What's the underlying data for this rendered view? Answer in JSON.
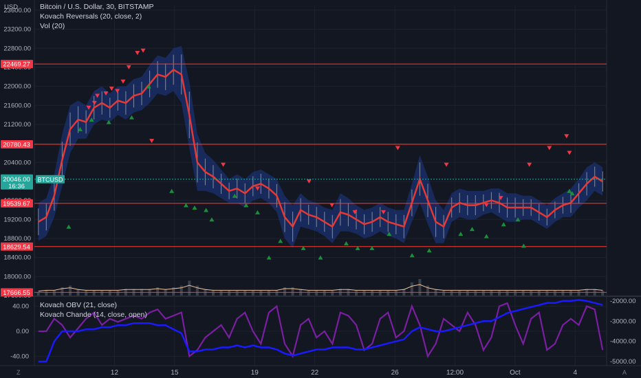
{
  "chart_data": {
    "type": "line",
    "instrument": "Bitcoin / U.S. Dollar, 30, BITSTAMP",
    "currency_label": "USD",
    "indicators_top": [
      "Kovach Reversals (20, close, 2)",
      "Vol (20)"
    ],
    "indicators_bottom": [
      "Kovach OBV (21, close)",
      "Kovach Chande (14, close, open)"
    ],
    "price_axis": {
      "ylim": [
        17600,
        23700
      ],
      "ticks": [
        23600,
        23200,
        22800,
        22400,
        22000,
        21600,
        21200,
        20800,
        20400,
        20000,
        19600,
        19200,
        18800,
        18400,
        18000,
        17600
      ],
      "tick_labels": [
        "23600.00",
        "23200.00",
        "22800.00",
        "22400.00",
        "22000.00",
        "21600.00",
        "21200.00",
        "20800.00",
        "20400.00",
        "20000.00",
        "19600.00",
        "19200.00",
        "18800.00",
        "18400.00",
        "18000.00",
        "17600.00"
      ]
    },
    "levels": [
      {
        "value": 22469.27,
        "label": "22469.27"
      },
      {
        "value": 20780.43,
        "label": "20780.43"
      },
      {
        "value": 19539.67,
        "label": "19539.67"
      },
      {
        "value": 18629.54,
        "label": "18629.54"
      },
      {
        "value": 17666.55,
        "label": "17666.55"
      }
    ],
    "current_price": {
      "value": 20046.0,
      "label": "20046.00",
      "countdown": "16:36",
      "symbol": "BTCUSD"
    },
    "x_ticks": [
      {
        "label": "12",
        "t": 0.14
      },
      {
        "label": "15",
        "t": 0.245
      },
      {
        "label": "19",
        "t": 0.385
      },
      {
        "label": "22",
        "t": 0.49
      },
      {
        "label": "26",
        "t": 0.63
      },
      {
        "label": "12:00",
        "t": 0.735
      },
      {
        "label": "Oct",
        "t": 0.84
      },
      {
        "label": "4",
        "t": 0.945
      }
    ],
    "price_series": [
      19150,
      19250,
      19700,
      20450,
      21100,
      21300,
      21250,
      21550,
      21650,
      21550,
      21700,
      21650,
      21800,
      21850,
      22050,
      22250,
      22200,
      22350,
      22250,
      21400,
      20400,
      20200,
      20100,
      19950,
      19800,
      19850,
      19750,
      19900,
      19950,
      19850,
      19700,
      19250,
      19050,
      19400,
      19300,
      19250,
      19150,
      19050,
      19350,
      19300,
      19200,
      19100,
      19150,
      19250,
      19150,
      19100,
      19050,
      19550,
      20050,
      19600,
      19150,
      19050,
      19450,
      19550,
      19500,
      19500,
      19550,
      19600,
      19550,
      19450,
      19450,
      19450,
      19450,
      19350,
      19250,
      19400,
      19500,
      19550,
      19750,
      19950,
      20100,
      20000
    ],
    "band_series": [
      400,
      400,
      450,
      550,
      500,
      400,
      350,
      350,
      350,
      300,
      300,
      350,
      350,
      350,
      400,
      400,
      400,
      450,
      600,
      700,
      600,
      400,
      350,
      300,
      250,
      300,
      300,
      300,
      300,
      300,
      350,
      450,
      450,
      350,
      300,
      300,
      300,
      350,
      400,
      350,
      300,
      300,
      300,
      300,
      300,
      300,
      350,
      400,
      500,
      500,
      450,
      350,
      300,
      300,
      300,
      300,
      250,
      250,
      300,
      300,
      300,
      250,
      250,
      250,
      250,
      250,
      250,
      300,
      300,
      350,
      300,
      300
    ],
    "reversal_down": [
      [
        0.095,
        21550
      ],
      [
        0.105,
        21650
      ],
      [
        0.11,
        21800
      ],
      [
        0.125,
        21850
      ],
      [
        0.135,
        21950
      ],
      [
        0.145,
        21900
      ],
      [
        0.155,
        22100
      ],
      [
        0.165,
        22400
      ],
      [
        0.18,
        22700
      ],
      [
        0.19,
        22750
      ],
      [
        0.205,
        20850
      ],
      [
        0.33,
        20350
      ],
      [
        0.39,
        19850
      ],
      [
        0.48,
        20000
      ],
      [
        0.52,
        19500
      ],
      [
        0.56,
        19350
      ],
      [
        0.61,
        19350
      ],
      [
        0.635,
        20700
      ],
      [
        0.72,
        20350
      ],
      [
        0.79,
        19500
      ],
      [
        0.815,
        19650
      ],
      [
        0.865,
        20350
      ],
      [
        0.9,
        20700
      ],
      [
        0.93,
        20950
      ],
      [
        0.935,
        20600
      ]
    ],
    "reversal_up": [
      [
        0.06,
        19050
      ],
      [
        0.08,
        21100
      ],
      [
        0.1,
        21300
      ],
      [
        0.13,
        21250
      ],
      [
        0.17,
        21350
      ],
      [
        0.2,
        22000
      ],
      [
        0.24,
        19800
      ],
      [
        0.265,
        19500
      ],
      [
        0.28,
        19450
      ],
      [
        0.3,
        19400
      ],
      [
        0.31,
        19200
      ],
      [
        0.35,
        19700
      ],
      [
        0.37,
        19500
      ],
      [
        0.39,
        19350
      ],
      [
        0.41,
        18400
      ],
      [
        0.43,
        18750
      ],
      [
        0.47,
        18600
      ],
      [
        0.5,
        18400
      ],
      [
        0.545,
        18700
      ],
      [
        0.565,
        18600
      ],
      [
        0.59,
        18600
      ],
      [
        0.62,
        18900
      ],
      [
        0.66,
        18450
      ],
      [
        0.69,
        18550
      ],
      [
        0.745,
        18900
      ],
      [
        0.765,
        19000
      ],
      [
        0.79,
        18850
      ],
      [
        0.82,
        19100
      ],
      [
        0.845,
        19200
      ],
      [
        0.855,
        18650
      ],
      [
        0.935,
        19800
      ],
      [
        0.94,
        19750
      ]
    ],
    "volume_series": [
      0.2,
      0.3,
      0.3,
      0.5,
      0.6,
      0.4,
      0.3,
      0.3,
      0.3,
      0.3,
      0.3,
      0.4,
      0.4,
      0.4,
      0.4,
      0.5,
      0.4,
      0.5,
      0.6,
      0.9,
      0.6,
      0.4,
      0.3,
      0.3,
      0.3,
      0.3,
      0.3,
      0.3,
      0.3,
      0.3,
      0.3,
      0.5,
      0.5,
      0.4,
      0.3,
      0.3,
      0.3,
      0.3,
      0.4,
      0.4,
      0.3,
      0.3,
      0.3,
      0.3,
      0.3,
      0.3,
      0.4,
      0.8,
      1.0,
      0.6,
      0.4,
      0.3,
      0.3,
      0.3,
      0.3,
      0.3,
      0.3,
      0.3,
      0.3,
      0.3,
      0.3,
      0.3,
      0.3,
      0.3,
      0.3,
      0.3,
      0.3,
      0.3,
      0.3,
      0.4,
      0.4,
      0.3
    ],
    "oscillator_axis": {
      "left_ylim": [
        -55,
        55
      ],
      "left_ticks": [
        40,
        0,
        -40
      ],
      "left_tick_labels": [
        "40.00",
        "0.00",
        "-40.00"
      ],
      "right_ylim": [
        -5200,
        -1800
      ],
      "right_ticks": [
        -2000,
        -3000,
        -4000,
        -5000
      ],
      "right_tick_labels": [
        "-2000.00",
        "-3000.00",
        "-4000.00",
        "-5000.00"
      ]
    },
    "obv_series": [
      -5000,
      -5000,
      -4000,
      -3500,
      -3500,
      -3500,
      -3400,
      -3400,
      -3300,
      -3300,
      -3200,
      -3200,
      -3100,
      -3100,
      -3100,
      -3200,
      -3200,
      -3400,
      -3600,
      -4500,
      -4500,
      -4400,
      -4400,
      -4300,
      -4300,
      -4200,
      -4300,
      -4200,
      -4300,
      -4300,
      -4400,
      -4600,
      -4700,
      -4600,
      -4500,
      -4400,
      -4400,
      -4300,
      -4300,
      -4300,
      -4400,
      -4400,
      -4300,
      -4200,
      -4100,
      -4000,
      -3900,
      -3500,
      -3300,
      -3400,
      -3500,
      -3500,
      -3400,
      -3300,
      -3200,
      -3100,
      -3000,
      -3000,
      -2800,
      -2600,
      -2500,
      -2400,
      -2300,
      -2200,
      -2100,
      -2100,
      -2000,
      -2000,
      -1950,
      -2000,
      -2100,
      -2200
    ],
    "chande_series": [
      0,
      0,
      20,
      10,
      -10,
      5,
      20,
      30,
      10,
      20,
      15,
      20,
      25,
      20,
      30,
      35,
      20,
      25,
      30,
      -40,
      -30,
      -10,
      0,
      10,
      -10,
      20,
      30,
      0,
      -20,
      30,
      40,
      -20,
      -40,
      10,
      20,
      -10,
      0,
      -20,
      30,
      25,
      10,
      -30,
      -20,
      20,
      30,
      -10,
      0,
      40,
      10,
      -40,
      -20,
      20,
      10,
      0,
      30,
      10,
      -30,
      -10,
      40,
      45,
      10,
      -20,
      20,
      30,
      -30,
      -20,
      10,
      20,
      10,
      40,
      35,
      -30
    ]
  }
}
